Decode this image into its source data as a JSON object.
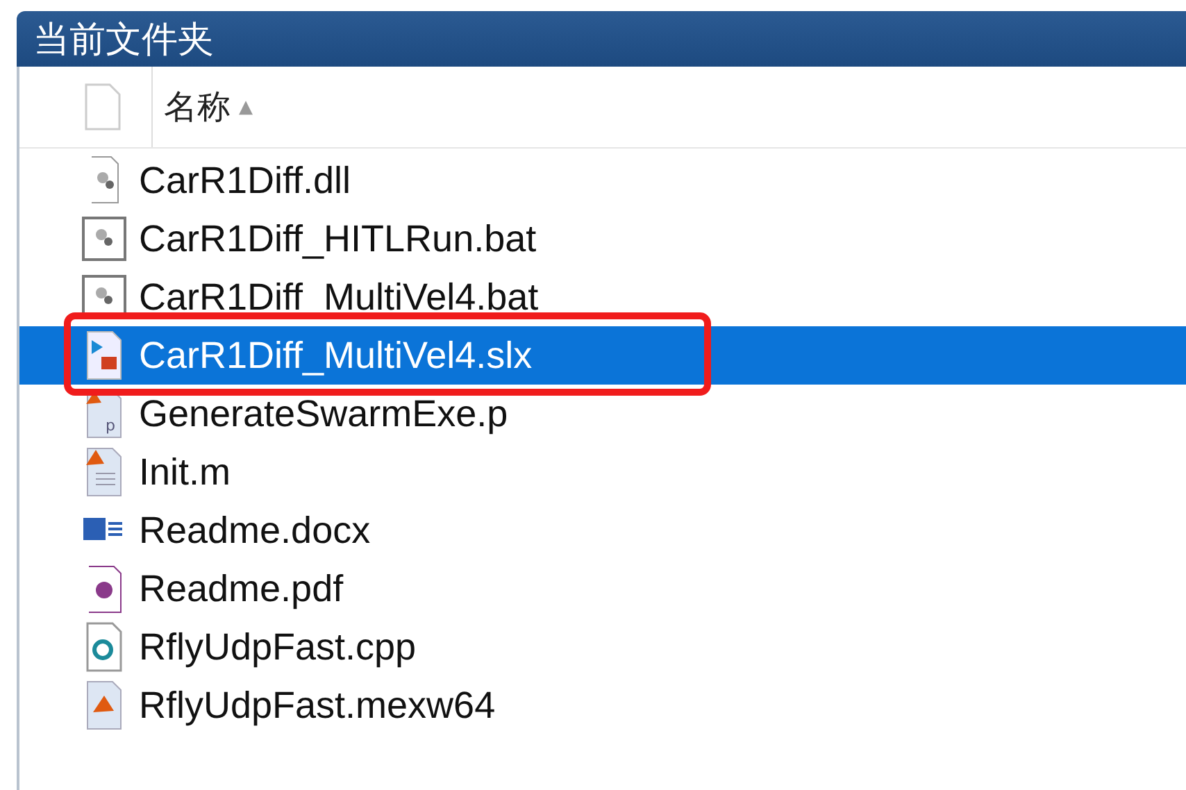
{
  "window": {
    "title": "当前文件夹"
  },
  "header": {
    "column_1": "名称",
    "sort_indicator": "▲"
  },
  "files": [
    {
      "name": "CarR1Diff.dll",
      "kind": "dll",
      "selected": false,
      "annotated": false
    },
    {
      "name": "CarR1Diff_HITLRun.bat",
      "kind": "bat",
      "selected": false,
      "annotated": false
    },
    {
      "name": "CarR1Diff_MultiVel4.bat",
      "kind": "bat",
      "selected": false,
      "annotated": false
    },
    {
      "name": "CarR1Diff_MultiVel4.slx",
      "kind": "slx",
      "selected": true,
      "annotated": true
    },
    {
      "name": "GenerateSwarmExe.p",
      "kind": "p",
      "selected": false,
      "annotated": false
    },
    {
      "name": "Init.m",
      "kind": "m",
      "selected": false,
      "annotated": false
    },
    {
      "name": "Readme.docx",
      "kind": "docx",
      "selected": false,
      "annotated": false
    },
    {
      "name": "Readme.pdf",
      "kind": "pdf",
      "selected": false,
      "annotated": false
    },
    {
      "name": "RflyUdpFast.cpp",
      "kind": "cpp",
      "selected": false,
      "annotated": false
    },
    {
      "name": "RflyUdpFast.mexw64",
      "kind": "mexw64",
      "selected": false,
      "annotated": false
    }
  ]
}
